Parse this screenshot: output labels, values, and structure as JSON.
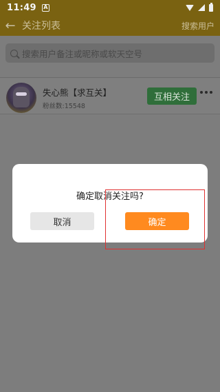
{
  "status_bar": {
    "time": "11:49",
    "notif_letter": "A"
  },
  "app_bar": {
    "title": "关注列表",
    "search_user": "搜索用户"
  },
  "search": {
    "placeholder": "搜索用户备注或昵称或软天空号"
  },
  "follow_list": [
    {
      "name": "失心熊【求互关】",
      "fans": "粉丝数:15548",
      "button": "互相关注"
    }
  ],
  "dialog": {
    "message": "确定取消关注吗?",
    "cancel": "取消",
    "confirm": "确定"
  },
  "colors": {
    "confirm": "#ff8a1f",
    "follow_button": "#2f6e3a",
    "highlight": "#e03030"
  }
}
